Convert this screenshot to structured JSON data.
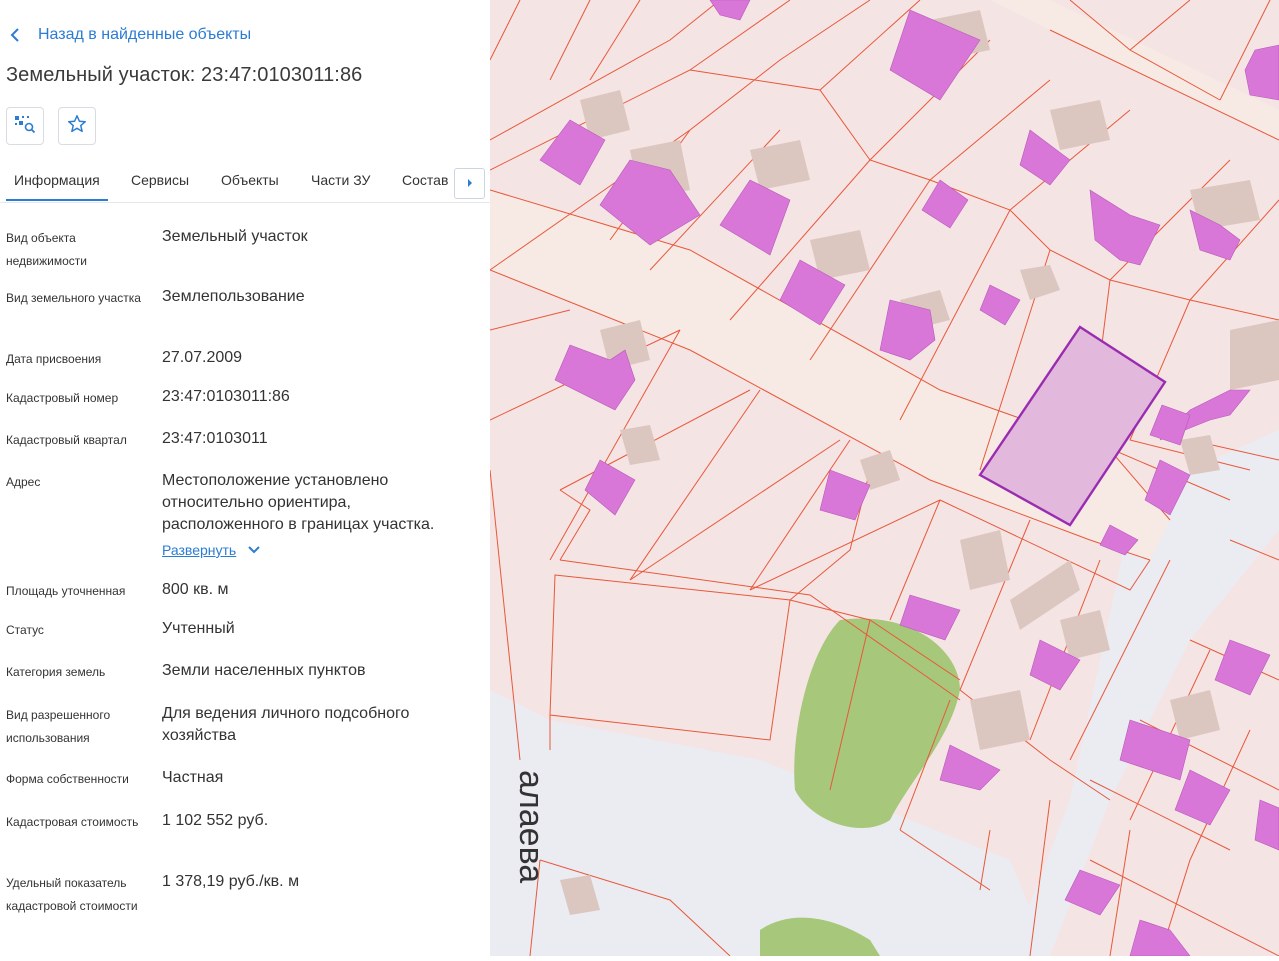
{
  "header": {
    "back_label": "Назад в найденные объекты",
    "title": "Земельный участок: 23:47:0103011:86"
  },
  "toolbar": {
    "locate_icon": "map-search-icon",
    "favorite_icon": "star-icon"
  },
  "tabs": [
    {
      "label": "Информация",
      "active": true
    },
    {
      "label": "Сервисы",
      "active": false
    },
    {
      "label": "Объекты",
      "active": false
    },
    {
      "label": "Части ЗУ",
      "active": false
    },
    {
      "label": "Состав",
      "active": false
    }
  ],
  "details": {
    "object_type": {
      "label": "Вид объекта недвижимости",
      "value": "Земельный участок"
    },
    "plot_type": {
      "label": "Вид земельного участка",
      "value": "Землепользование"
    },
    "assign_date": {
      "label": "Дата присвоения",
      "value": "27.07.2009"
    },
    "cad_number": {
      "label": "Кадастровый номер",
      "value": "23:47:0103011:86"
    },
    "cad_quarter": {
      "label": "Кадастровый квартал",
      "value": "23:47:0103011"
    },
    "address": {
      "label": "Адрес",
      "value": "Местоположение установлено относительно ориентира, расположенного в границах участка.",
      "expand_label": "Развернуть"
    },
    "area": {
      "label": "Площадь уточненная",
      "value": "800 кв. м"
    },
    "status": {
      "label": "Статус",
      "value": "Учтенный"
    },
    "category": {
      "label": "Категория земель",
      "value": "Земли населенных пунктов"
    },
    "permitted_use": {
      "label": "Вид разрешенного использования",
      "value": "Для ведения личного подсобного хозяйства"
    },
    "ownership": {
      "label": "Форма собственности",
      "value": "Частная"
    },
    "cad_value": {
      "label": "Кадастровая стоимость",
      "value": "1 102 552 руб."
    },
    "specific_value": {
      "label": "Удельный показатель кадастровой стоимости",
      "value": "1 378,19 руб./кв. м"
    }
  },
  "map": {
    "street_label": "алаева",
    "colors": {
      "parcel_fill": "#f6e3e3",
      "parcel_border": "#e8583a",
      "building_fill": "#d877d8",
      "selected_fill": "#e2b9dd",
      "selected_border": "#9a2cb0",
      "greenery": "#a7c77a",
      "road": "#ebebf2"
    }
  }
}
